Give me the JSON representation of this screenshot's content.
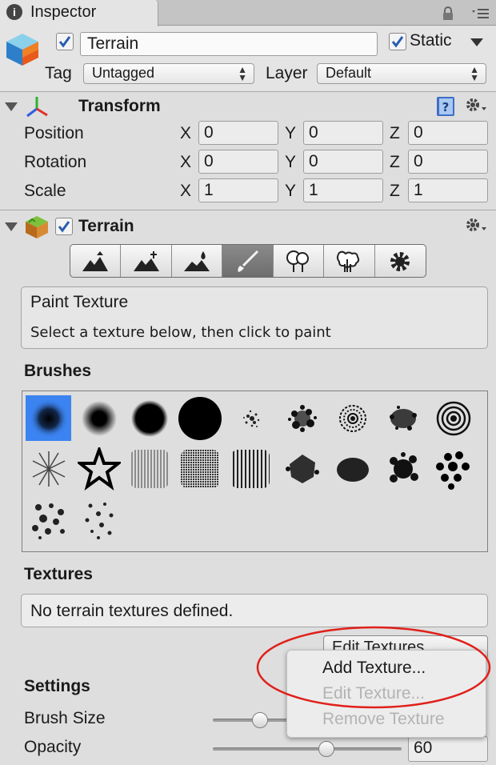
{
  "tab": {
    "label": "Inspector"
  },
  "header": {
    "name": "Terrain",
    "active_checked": true,
    "static_label": "Static",
    "static_checked": true,
    "tag_label": "Tag",
    "tag_value": "Untagged",
    "layer_label": "Layer",
    "layer_value": "Default"
  },
  "transform": {
    "title": "Transform",
    "rows": [
      {
        "label": "Position",
        "x": "0",
        "y": "0",
        "z": "0"
      },
      {
        "label": "Rotation",
        "x": "0",
        "y": "0",
        "z": "0"
      },
      {
        "label": "Scale",
        "x": "1",
        "y": "1",
        "z": "1"
      }
    ],
    "axes": {
      "x": "X",
      "y": "Y",
      "z": "Z"
    }
  },
  "terrain": {
    "title": "Terrain",
    "enabled": true,
    "tools": [
      "raise-lower-icon",
      "paint-height-icon",
      "smooth-height-icon",
      "paint-texture-icon",
      "place-trees-icon",
      "paint-details-icon",
      "settings-icon"
    ],
    "active_tool_index": 3,
    "info_title": "Paint Texture",
    "info_text": "Select a texture below, then click to paint"
  },
  "brushes": {
    "title": "Brushes",
    "count": 20,
    "selected_index": 0
  },
  "textures": {
    "title": "Textures",
    "empty_text": "No terrain textures defined.",
    "edit_button": "Edit Textures..."
  },
  "settings": {
    "title": "Settings",
    "brush_size_label": "Brush Size",
    "brush_size_fraction": 0.25,
    "opacity_label": "Opacity",
    "opacity_value": "60",
    "opacity_fraction": 0.6
  },
  "context_menu": {
    "items": [
      {
        "label": "Add Texture...",
        "enabled": true
      },
      {
        "label": "Edit Texture...",
        "enabled": false
      },
      {
        "label": "Remove Texture",
        "enabled": false
      }
    ]
  },
  "colors": {
    "selection_blue": "#3b83f1",
    "annotation_red": "#e0201a",
    "panel_bg": "#dedede"
  }
}
